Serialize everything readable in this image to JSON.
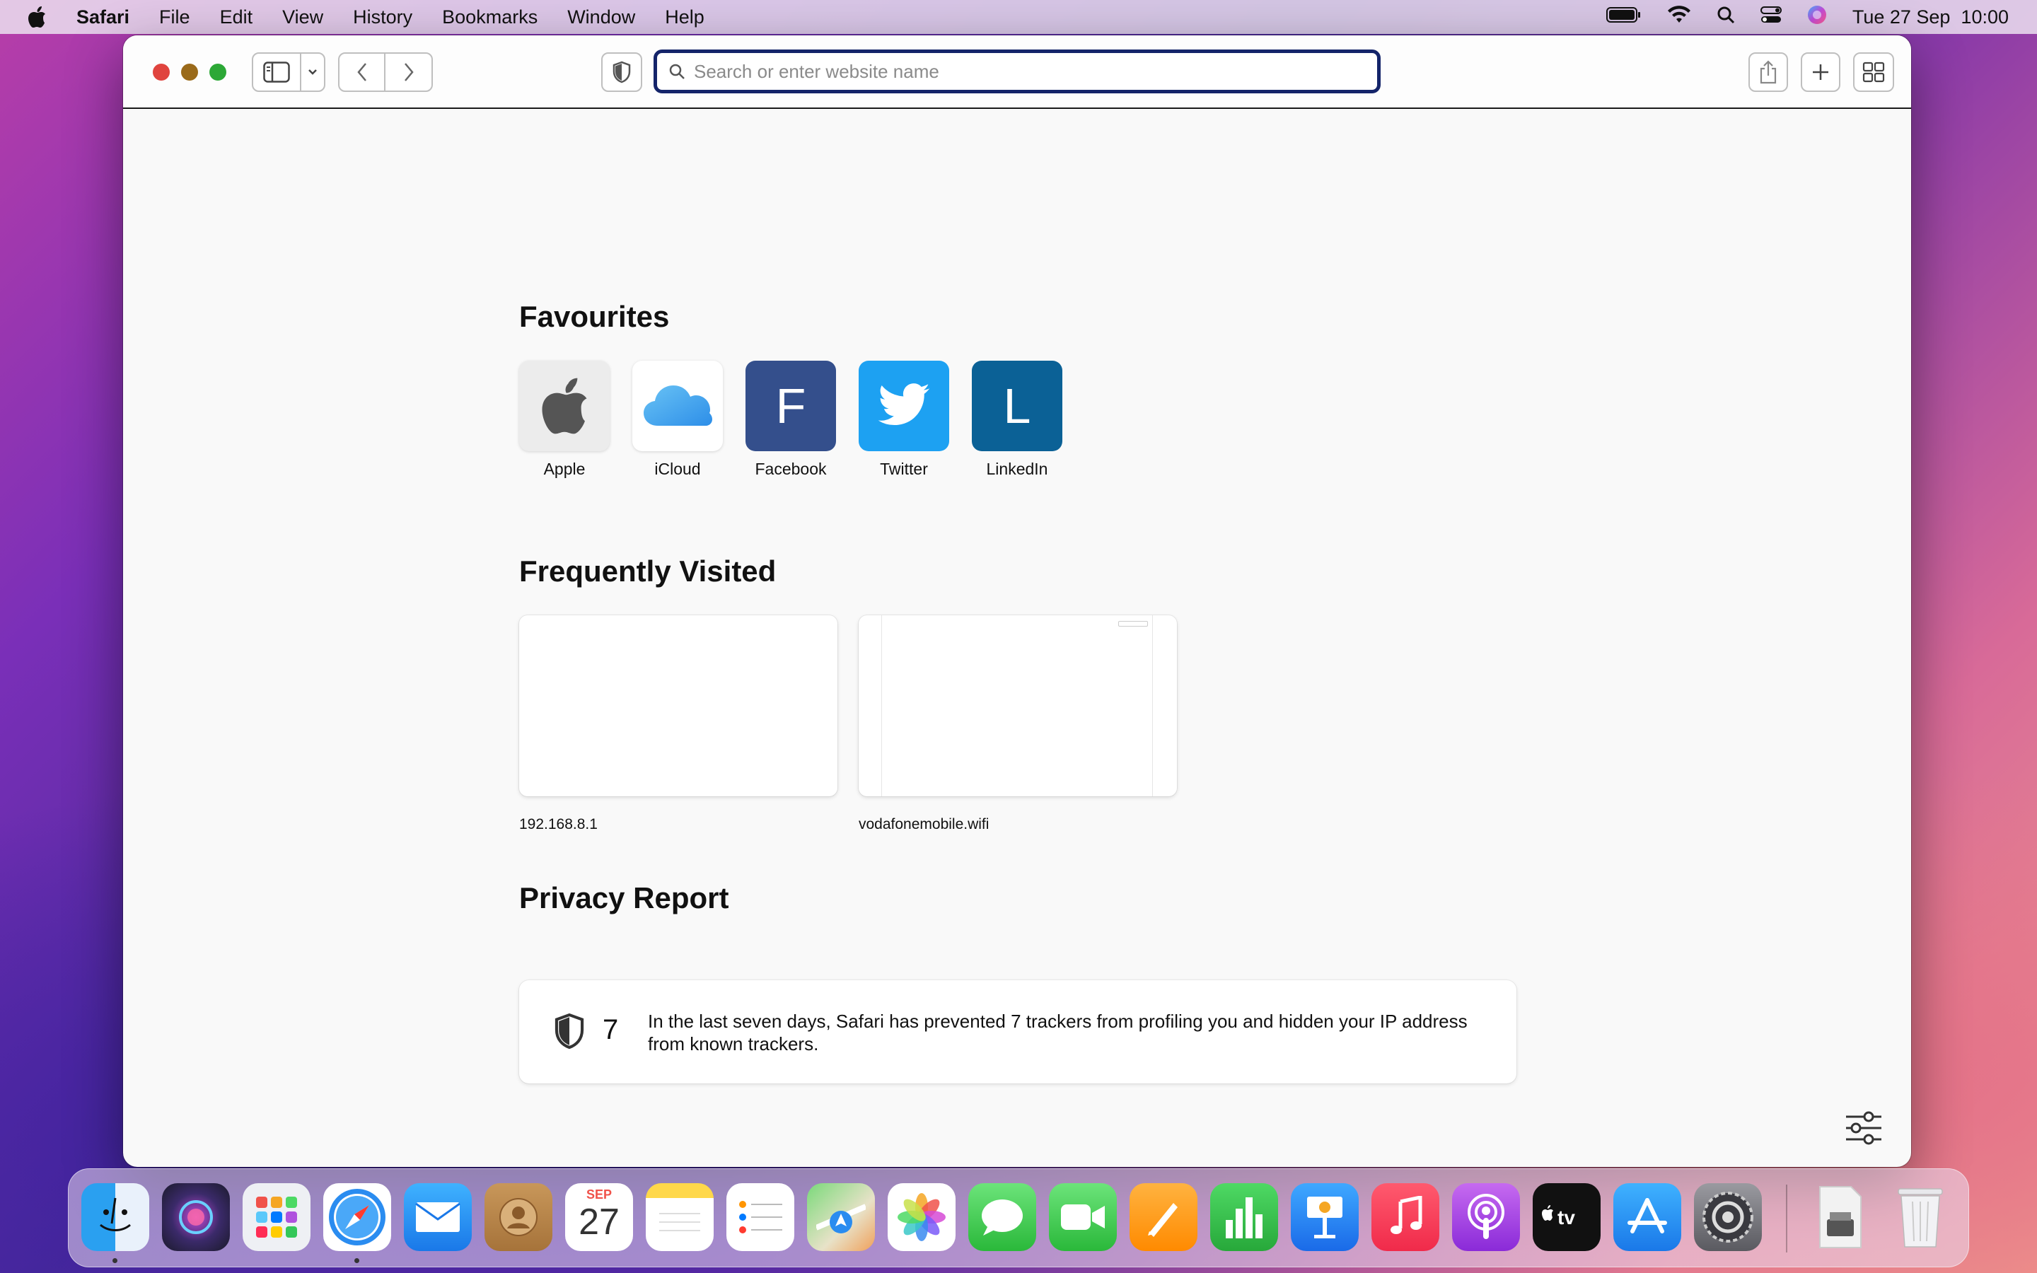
{
  "menubar": {
    "app_name": "Safari",
    "items": [
      "File",
      "Edit",
      "View",
      "History",
      "Bookmarks",
      "Window",
      "Help"
    ],
    "clock": "Tue 27 Sep  10:00",
    "icons": [
      "apple-icon",
      "battery-icon",
      "wifi-icon",
      "spotlight-icon",
      "control-center-icon",
      "siri-icon"
    ]
  },
  "toolbar": {
    "address_placeholder": "Search or enter website name"
  },
  "favourites": {
    "title": "Favourites",
    "items": [
      {
        "label": "Apple",
        "glyph": "",
        "color": "#ececec"
      },
      {
        "label": "iCloud",
        "glyph": "",
        "color": "#ffffff"
      },
      {
        "label": "Facebook",
        "glyph": "F",
        "color": "#344f8c"
      },
      {
        "label": "Twitter",
        "glyph": "",
        "color": "#1da1f2"
      },
      {
        "label": "LinkedIn",
        "glyph": "L",
        "color": "#0b6196"
      }
    ]
  },
  "frequently_visited": {
    "title": "Frequently Visited",
    "items": [
      {
        "label": "192.168.8.1"
      },
      {
        "label": "vodafonemobile.wifi"
      }
    ]
  },
  "privacy_report": {
    "title": "Privacy Report",
    "count": "7",
    "message": "In the last seven days, Safari has prevented 7 trackers from profiling you and hidden your IP address from known trackers."
  },
  "dock": {
    "calendar_month": "SEP",
    "calendar_day": "27",
    "apps": [
      "Finder",
      "Siri",
      "Launchpad",
      "Safari",
      "Mail",
      "Contacts",
      "Calendar",
      "Notes",
      "Reminders",
      "Maps",
      "Photos",
      "Messages",
      "FaceTime",
      "Pages",
      "Numbers",
      "Keynote",
      "Music",
      "Podcasts",
      "TV",
      "App Store",
      "System Preferences",
      "Downloads",
      "Trash"
    ]
  }
}
